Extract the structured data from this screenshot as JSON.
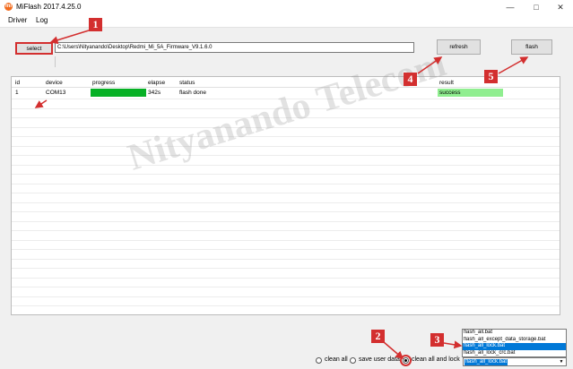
{
  "window": {
    "title": "MiFlash 2017.4.25.0",
    "app_icon": "mi-logo-icon",
    "accent": "#f26b1d"
  },
  "menu": {
    "items": [
      "Driver",
      "Log"
    ]
  },
  "toolbar": {
    "select_label": "select",
    "path_value": "C:\\Users\\Nityanando\\Desktop\\Redmi_Mi_5A_Firmware_V9.1.6.0",
    "refresh_label": "refresh",
    "flash_label": "flash"
  },
  "table": {
    "columns": [
      "id",
      "device",
      "progress",
      "elapse",
      "status",
      "result"
    ],
    "rows": [
      {
        "id": "1",
        "device": "COM13",
        "progress": 1.0,
        "elapse": "342s",
        "status": "flash done",
        "result": "success"
      }
    ],
    "progress_color": "#06b025",
    "result_color": "#90ee90"
  },
  "watermark": "Nityanando Telecom",
  "bottom": {
    "options": [
      {
        "label": "clean all",
        "checked": false
      },
      {
        "label": "save user data",
        "checked": false
      },
      {
        "label": "clean all and lock",
        "checked": true
      }
    ],
    "script_options": [
      "flash_all.bat",
      "flash_all_except_data_storage.bat",
      "flash_all_lock.bat",
      "flash_all_lock_crc.bat"
    ],
    "selected_script": "flash_all_lock.bat"
  },
  "annotations": {
    "badges": [
      "1",
      "2",
      "3",
      "4",
      "5"
    ],
    "color": "#d32f2f"
  }
}
